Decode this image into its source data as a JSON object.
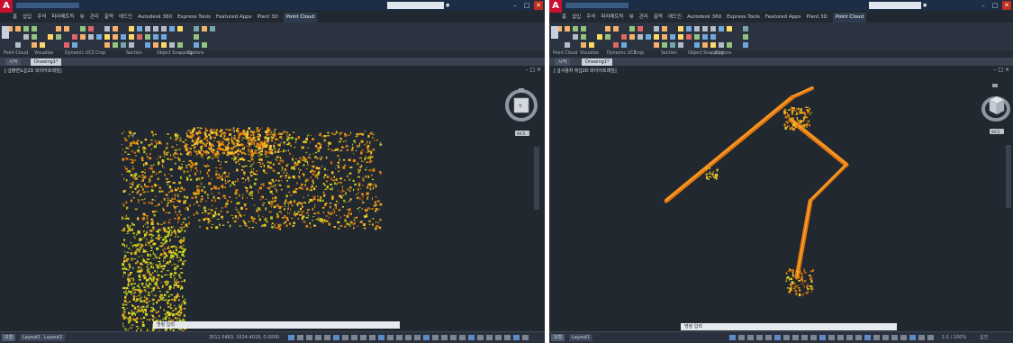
{
  "left_window": {
    "app_logo": "A",
    "document_title": "",
    "tabs": [
      "홈",
      "삽입",
      "주석",
      "파라메트릭",
      "뷰",
      "관리",
      "출력",
      "애드인",
      "Autodesk 360",
      "Express Tools",
      "Featured Apps",
      "Plant 3D",
      "Point Cloud"
    ],
    "active_tab": "Point Cloud",
    "panels": [
      "Point Cloud",
      "Visualize",
      "Dynamic UCS",
      "Crop",
      "Section",
      "Object Snapping",
      "Options"
    ],
    "doc_tabs": [
      "시작",
      "Drawing1*"
    ],
    "viewport_label": "[-][평면도][2D 와이어프레임]",
    "viewcube_label": "북",
    "wcs_label": "WCS",
    "axis_y": "Y",
    "command_placeholder": "명령 입력",
    "layout_tabs": [
      "모형",
      "Layout1",
      "Layout2"
    ],
    "status_coords": "3512.5463, 1024.4018, 0.0000"
  },
  "right_window": {
    "app_logo": "A",
    "document_title": "",
    "tabs": [
      "홈",
      "삽입",
      "주석",
      "파라메트릭",
      "뷰",
      "관리",
      "출력",
      "애드인",
      "Autodesk 360",
      "Express Tools",
      "Featured Apps",
      "Plant 3D",
      "Point Cloud"
    ],
    "active_tab": "Point Cloud",
    "panels": [
      "Point Cloud",
      "Visualize",
      "Dynamic UCS",
      "Crop",
      "Section",
      "Object Snapping",
      "Options"
    ],
    "doc_tabs": [
      "시작",
      "Drawing1*"
    ],
    "viewport_label": "[-][사용자 뷰][2D 와이어프레임]",
    "wcs_label": "WCS",
    "command_placeholder": "명령 입력",
    "layout_tabs": [
      "모형",
      "Layout1"
    ],
    "status_scale": "1:1 / 100%",
    "status_unit": "십진"
  },
  "colors": {
    "background": "#212830",
    "title_bar": "#1c2d45",
    "ribbon": "#2b3340",
    "point_cloud_orange": "#e8820c",
    "point_cloud_yellow": "#e6d020"
  }
}
